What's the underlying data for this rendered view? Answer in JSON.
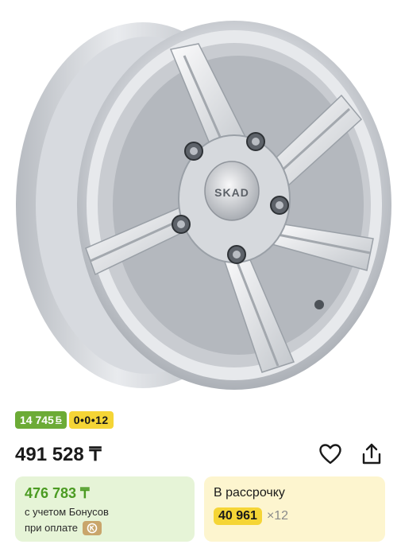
{
  "product_image": {
    "brand_logo_text": "SKAD",
    "icon": "alloy-wheel-image"
  },
  "badges": {
    "bonus": {
      "amount": "14 745",
      "symbol": "Б"
    },
    "installment": {
      "label": "0•0•12"
    }
  },
  "price": {
    "value": "491 528 ₸",
    "favorite_icon": "heart-icon",
    "share_icon": "share-icon"
  },
  "bonus_card": {
    "price": "476 783 ₸",
    "line1": "с учетом Бонусов",
    "line2": "при оплате",
    "icon": "kaspi-gold-icon"
  },
  "installment_card": {
    "title": "В рассрочку",
    "amount": "40 961",
    "months": "×12"
  },
  "colors": {
    "green": "#6cab36",
    "yellow": "#f5d536",
    "green_card": "#e6f4d7",
    "yellow_card": "#fdf5cf"
  }
}
